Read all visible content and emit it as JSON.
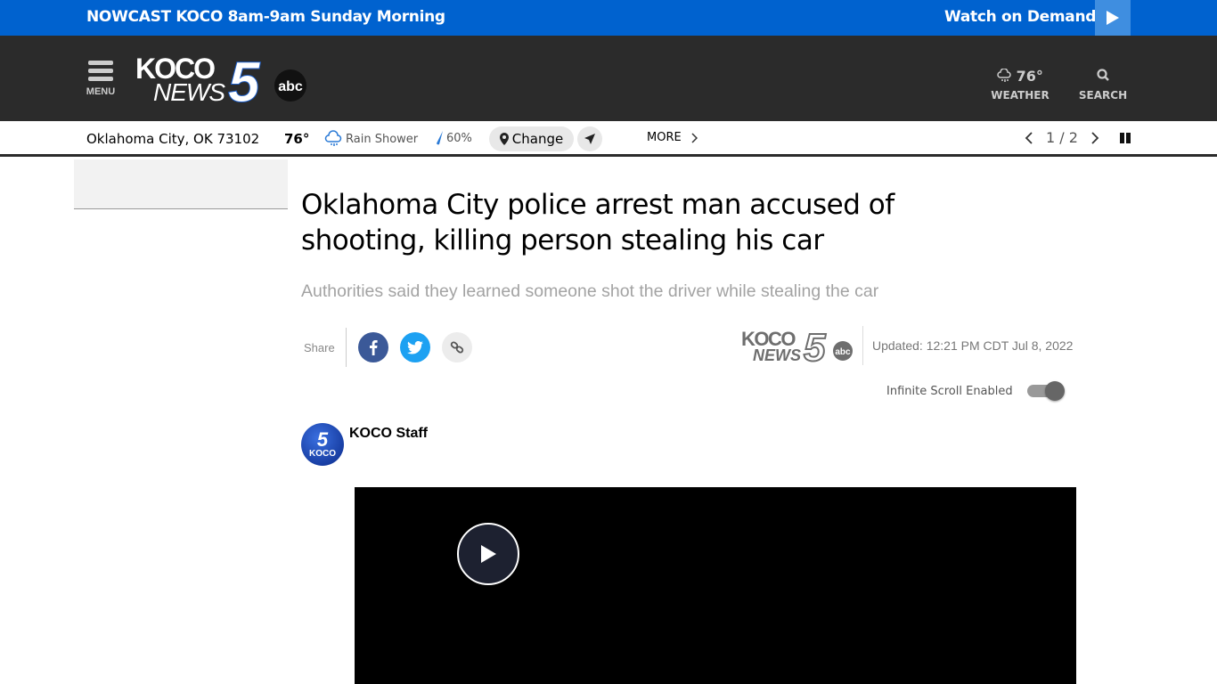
{
  "topbar": {
    "nowcast": "NOWCAST KOCO 8am-9am Sunday Morning",
    "watch_on_demand": "Watch on Demand"
  },
  "header": {
    "menu_label": "MENU",
    "logo": {
      "line1": "KOCO",
      "line2": "NEWS",
      "number": "5",
      "network": "abc"
    },
    "weather": {
      "temp": "76°",
      "label": "WEATHER"
    },
    "search_label": "SEARCH"
  },
  "weather_bar": {
    "location": "Oklahoma City, OK 73102",
    "temp": "76°",
    "condition": "Rain Shower",
    "precip": "60%",
    "change_label": "Change",
    "more_label": "MORE",
    "pager": "1 / 2"
  },
  "article": {
    "headline": "Oklahoma City police arrest man accused of shooting, killing person stealing his car",
    "dek": "Authorities said they learned someone shot the driver while stealing the car",
    "share_label": "Share",
    "updated": "Updated: 12:21 PM CDT Jul 8, 2022",
    "infinite_scroll_label": "Infinite Scroll Enabled",
    "infinite_scroll_enabled": true,
    "author": {
      "name": "KOCO Staff",
      "avatar_text": "KOCO",
      "avatar_number": "5"
    }
  },
  "colors": {
    "brand_blue": "#0062cf",
    "header_bg": "#2b2b2b",
    "facebook": "#3b5998",
    "twitter": "#1da1f2"
  }
}
